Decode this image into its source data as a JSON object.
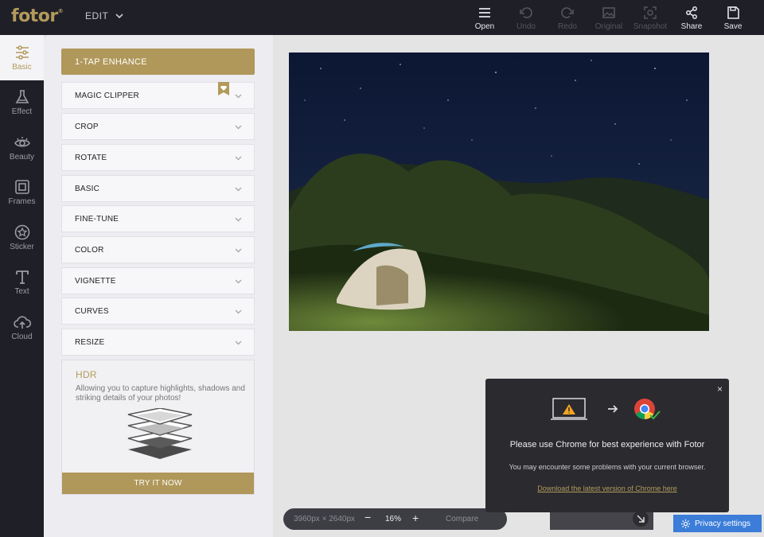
{
  "app": {
    "logo": "fotor",
    "logo_mark": "®",
    "menu_label": "EDIT"
  },
  "toolbar": [
    {
      "label": "Open",
      "icon": "menu-icon",
      "enabled": true
    },
    {
      "label": "Undo",
      "icon": "undo-icon",
      "enabled": false
    },
    {
      "label": "Redo",
      "icon": "redo-icon",
      "enabled": false
    },
    {
      "label": "Original",
      "icon": "image-icon",
      "enabled": false
    },
    {
      "label": "Snapshot",
      "icon": "camera-icon",
      "enabled": false
    },
    {
      "label": "Share",
      "icon": "share-icon",
      "enabled": true
    },
    {
      "label": "Save",
      "icon": "save-icon",
      "enabled": true
    }
  ],
  "sidebar": {
    "items": [
      {
        "label": "Basic",
        "icon": "sliders-icon",
        "active": true
      },
      {
        "label": "Effect",
        "icon": "flask-icon",
        "active": false
      },
      {
        "label": "Beauty",
        "icon": "eye-icon",
        "active": false
      },
      {
        "label": "Frames",
        "icon": "frame-icon",
        "active": false
      },
      {
        "label": "Sticker",
        "icon": "star-icon",
        "active": false
      },
      {
        "label": "Text",
        "icon": "text-icon",
        "active": false
      },
      {
        "label": "Cloud",
        "icon": "cloud-upload-icon",
        "active": false
      }
    ]
  },
  "panel": {
    "enhance_label": "1-TAP ENHANCE",
    "tools": [
      "MAGIC CLIPPER",
      "CROP",
      "ROTATE",
      "BASIC",
      "FINE-TUNE",
      "COLOR",
      "VIGNETTE",
      "CURVES",
      "RESIZE"
    ],
    "hdr": {
      "title": "HDR",
      "description": "Allowing you to capture highlights, shadows and striking details of your photos!",
      "button": "TRY IT NOW"
    }
  },
  "zoom": {
    "dimensions": "3960px × 2640px",
    "minus": "−",
    "value": "16%",
    "plus": "+",
    "compare": "Compare"
  },
  "popup": {
    "close": "×",
    "title": "Please use Chrome for best experience with Fotor",
    "subtitle": "You may encounter some problems with your current browser.",
    "link": "Download the latest version of Chrome here"
  },
  "privacy": {
    "label": "Privacy settings"
  },
  "colors": {
    "accent": "#b0975a",
    "topbar": "#1f1f27",
    "privacy": "#3b7dd8"
  }
}
